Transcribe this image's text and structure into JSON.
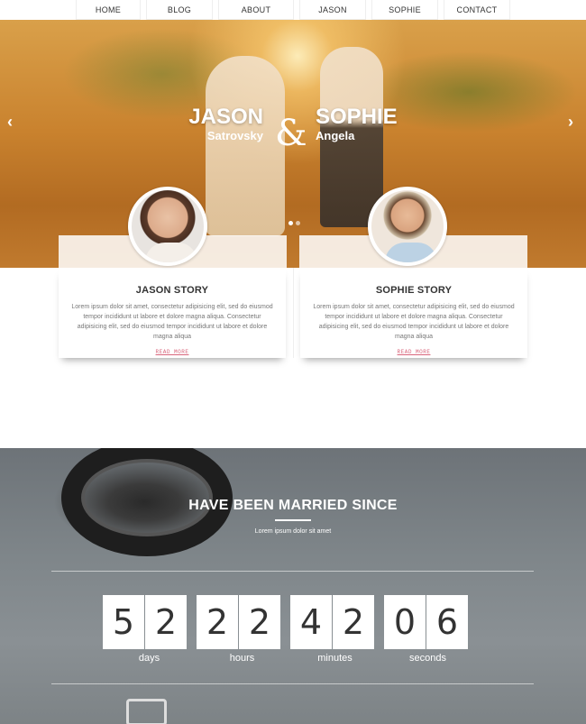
{
  "nav": [
    "HOME",
    "BLOG",
    "ABOUT",
    "JASON",
    "SOPHIE",
    "CONTACT"
  ],
  "hero": {
    "left_first": "JASON",
    "left_last": "Satrovsky",
    "amp": "&",
    "right_first": "SOPHIE",
    "right_last": "Angela",
    "prev_icon": "‹",
    "next_icon": "›"
  },
  "stories": [
    {
      "title": "JASON STORY",
      "text": "Lorem ipsum dolor sit amet, consectetur adipisicing elit, sed do eiusmod tempor incididunt ut labore et dolore magna aliqua. Consectetur adipisicing elit, sed do eiusmod tempor incididunt ut labore et dolore magna aliqua",
      "more": "READ MORE"
    },
    {
      "title": "SOPHIE STORY",
      "text": "Lorem ipsum dolor sit amet, consectetur adipisicing elit, sed do eiusmod tempor incididunt ut labore et dolore magna aliqua. Consectetur adipisicing elit, sed do eiusmod tempor incididunt ut labore et dolore magna aliqua",
      "more": "READ MORE"
    }
  ],
  "counter": {
    "title": "HAVE BEEN MARRIED SINCE",
    "subtitle": "Lorem ipsum dolor sit amet",
    "groups": [
      {
        "digits": [
          "5",
          "2"
        ],
        "label": "days"
      },
      {
        "digits": [
          "2",
          "2"
        ],
        "label": "hours"
      },
      {
        "digits": [
          "4",
          "2"
        ],
        "label": "minutes"
      },
      {
        "digits": [
          "0",
          "6"
        ],
        "label": "seconds"
      }
    ]
  }
}
